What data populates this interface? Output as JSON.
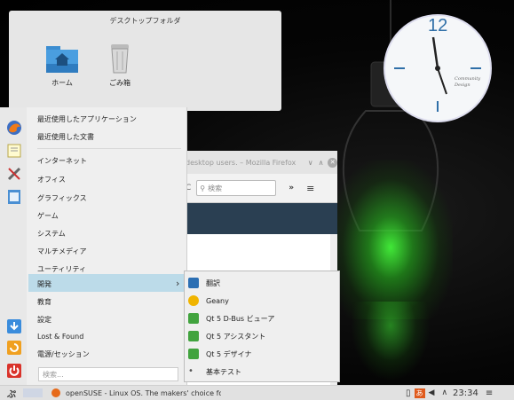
{
  "desktop": {
    "folder_title": "デスクトップフォルダ",
    "icons": [
      {
        "label": "ホーム",
        "icon": "home-folder-icon"
      },
      {
        "label": "ごみ箱",
        "icon": "trash-icon"
      }
    ],
    "clock": {
      "numeral": "12",
      "caption": "Community Design"
    }
  },
  "firefox": {
    "title": "desktop users. – Mozilla Firefox",
    "search_placeholder": "検索",
    "overflow": "»"
  },
  "menu": {
    "top": [
      "最近使用したアプリケーション",
      "最近使用した文書"
    ],
    "items": [
      "インターネット",
      "オフィス",
      "グラフィックス",
      "ゲーム",
      "システム",
      "マルチメディア",
      "ユーティリティ",
      "開発",
      "教育",
      "設定",
      "Lost & Found",
      "電源/セッション"
    ],
    "selected_arrow": "›",
    "search_placeholder": "検索..."
  },
  "submenu": {
    "items": [
      {
        "label": "翻訳",
        "color": "#2c6fb3"
      },
      {
        "label": "Geany",
        "color": "#f0b400"
      },
      {
        "label": "Qt 5 D-Bus ビューア",
        "color": "#41a33e"
      },
      {
        "label": "Qt 5 アシスタント",
        "color": "#41a33e"
      },
      {
        "label": "Qt 5 デザイナ",
        "color": "#41a33e"
      },
      {
        "label": "基本テスト",
        "color": "#555555"
      }
    ]
  },
  "taskbar": {
    "task_title": "openSUSE - Linux OS. The makers' choice for ...",
    "time": "23:34"
  },
  "colors": {
    "accent": "#bcdbe9",
    "green_glow": "#3cff3c"
  }
}
